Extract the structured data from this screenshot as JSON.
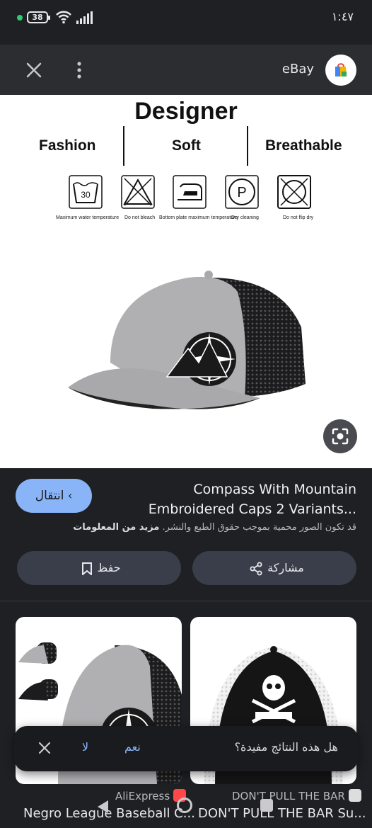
{
  "status_bar": {
    "battery": "38",
    "time": "١:٤٧"
  },
  "top_bar": {
    "title": "eBay"
  },
  "hero": {
    "title": "Designer",
    "features": [
      "Fashion",
      "Soft",
      "Breathable"
    ],
    "care_labels": [
      "Maximum water temperature",
      "Do not bleach",
      "Bottom plate maximum temperature",
      "Dry cleaning",
      "Do not flip dry"
    ],
    "wash_temp": "30",
    "dry_clean_letter": "P"
  },
  "result": {
    "go_label": "انتقال",
    "title_line1": "Compass With Mountain",
    "title_line2": "Embroidered Caps 2 Variants...",
    "copyright": "قد تكون الصور محمية بموجب حقوق الطبع والنشر.",
    "more_info": "مزيد من المعلومات",
    "save_label": "حفظ",
    "share_label": "مشاركة"
  },
  "related": [
    {
      "source": "AliExpress",
      "title": "Negro League Baseball C..."
    },
    {
      "source": "DON'T PULL THE BAR",
      "title": "DON'T PULL THE BAR Su..."
    }
  ],
  "feedback": {
    "question": "هل هذه النتائج مفيدة؟",
    "yes": "نعم",
    "no": "لا"
  },
  "colors": {
    "accent": "#8ab4f8",
    "background": "#1f2024",
    "surface": "#2b2d31",
    "pill": "#3a3e4a"
  }
}
